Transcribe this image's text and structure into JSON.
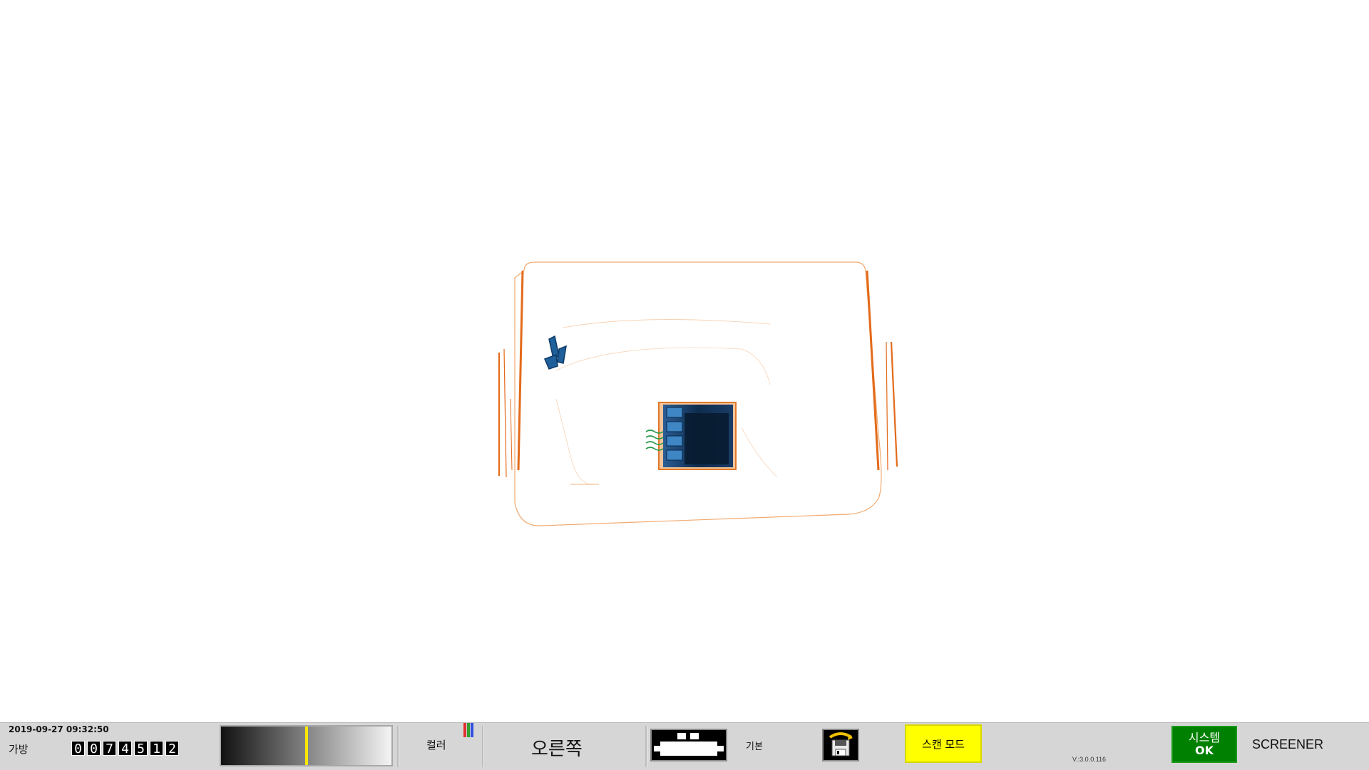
{
  "statusbar": {
    "datetime": "2019-09-27 09:32:50",
    "bag_label": "가방",
    "bag_counter": [
      "0",
      "0",
      "7",
      "4",
      "5",
      "1",
      "2"
    ],
    "gradient_marker": 0.5,
    "color_label": "컬러",
    "color_icon_colors": [
      "#e03030",
      "#30a030",
      "#3050e0"
    ],
    "direction": "오른쪽",
    "mode_label": "기본",
    "scan_mode_button": "스캔 모드",
    "version": "V.:3.0.0.116",
    "system_title": "시스템",
    "system_state": "OK",
    "user_role": "SCREENER",
    "colors": {
      "scan_mode_bg": "#ffff00",
      "system_ok_bg": "#008000",
      "statusbar_bg": "#d6d6d6",
      "organic_orange": "#e8782a",
      "metal_blue": "#1f5f9a"
    },
    "icons": [
      "conveyor-icon",
      "save-image-icon",
      "color-palette-icon"
    ]
  }
}
